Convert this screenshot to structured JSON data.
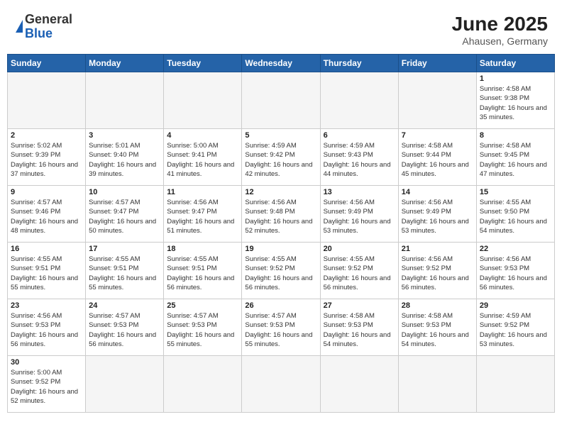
{
  "header": {
    "logo_general": "General",
    "logo_blue": "Blue",
    "month_title": "June 2025",
    "location": "Ahausen, Germany"
  },
  "calendar": {
    "days_of_week": [
      "Sunday",
      "Monday",
      "Tuesday",
      "Wednesday",
      "Thursday",
      "Friday",
      "Saturday"
    ],
    "weeks": [
      [
        {
          "day": "",
          "empty": true
        },
        {
          "day": "",
          "empty": true
        },
        {
          "day": "",
          "empty": true
        },
        {
          "day": "",
          "empty": true
        },
        {
          "day": "",
          "empty": true
        },
        {
          "day": "",
          "empty": true
        },
        {
          "day": "1",
          "info": "Sunrise: 4:58 AM\nSunset: 9:38 PM\nDaylight: 16 hours\nand 35 minutes."
        }
      ],
      [
        {
          "day": "2",
          "info": "Sunrise: 5:02 AM\nSunset: 9:39 PM\nDaylight: 16 hours\nand 37 minutes."
        },
        {
          "day": "3",
          "info": "Sunrise: 5:01 AM\nSunset: 9:40 PM\nDaylight: 16 hours\nand 39 minutes."
        },
        {
          "day": "4",
          "info": "Sunrise: 5:00 AM\nSunset: 9:41 PM\nDaylight: 16 hours\nand 41 minutes."
        },
        {
          "day": "5",
          "info": "Sunrise: 4:59 AM\nSunset: 9:42 PM\nDaylight: 16 hours\nand 42 minutes."
        },
        {
          "day": "6",
          "info": "Sunrise: 4:59 AM\nSunset: 9:43 PM\nDaylight: 16 hours\nand 44 minutes."
        },
        {
          "day": "7",
          "info": "Sunrise: 4:58 AM\nSunset: 9:44 PM\nDaylight: 16 hours\nand 45 minutes."
        },
        {
          "day": "8",
          "info": "Sunrise: 4:58 AM\nSunset: 9:45 PM\nDaylight: 16 hours\nand 47 minutes."
        }
      ],
      [
        {
          "day": "9",
          "info": "Sunrise: 4:57 AM\nSunset: 9:46 PM\nDaylight: 16 hours\nand 48 minutes."
        },
        {
          "day": "10",
          "info": "Sunrise: 4:57 AM\nSunset: 9:47 PM\nDaylight: 16 hours\nand 50 minutes."
        },
        {
          "day": "11",
          "info": "Sunrise: 4:56 AM\nSunset: 9:47 PM\nDaylight: 16 hours\nand 51 minutes."
        },
        {
          "day": "12",
          "info": "Sunrise: 4:56 AM\nSunset: 9:48 PM\nDaylight: 16 hours\nand 52 minutes."
        },
        {
          "day": "13",
          "info": "Sunrise: 4:56 AM\nSunset: 9:49 PM\nDaylight: 16 hours\nand 53 minutes."
        },
        {
          "day": "14",
          "info": "Sunrise: 4:56 AM\nSunset: 9:49 PM\nDaylight: 16 hours\nand 53 minutes."
        },
        {
          "day": "15",
          "info": "Sunrise: 4:55 AM\nSunset: 9:50 PM\nDaylight: 16 hours\nand 54 minutes."
        }
      ],
      [
        {
          "day": "16",
          "info": "Sunrise: 4:55 AM\nSunset: 9:51 PM\nDaylight: 16 hours\nand 55 minutes."
        },
        {
          "day": "17",
          "info": "Sunrise: 4:55 AM\nSunset: 9:51 PM\nDaylight: 16 hours\nand 55 minutes."
        },
        {
          "day": "18",
          "info": "Sunrise: 4:55 AM\nSunset: 9:51 PM\nDaylight: 16 hours\nand 56 minutes."
        },
        {
          "day": "19",
          "info": "Sunrise: 4:55 AM\nSunset: 9:52 PM\nDaylight: 16 hours\nand 56 minutes."
        },
        {
          "day": "20",
          "info": "Sunrise: 4:55 AM\nSunset: 9:52 PM\nDaylight: 16 hours\nand 56 minutes."
        },
        {
          "day": "21",
          "info": "Sunrise: 4:56 AM\nSunset: 9:52 PM\nDaylight: 16 hours\nand 56 minutes."
        },
        {
          "day": "22",
          "info": "Sunrise: 4:56 AM\nSunset: 9:53 PM\nDaylight: 16 hours\nand 56 minutes."
        }
      ],
      [
        {
          "day": "23",
          "info": "Sunrise: 4:56 AM\nSunset: 9:53 PM\nDaylight: 16 hours\nand 56 minutes."
        },
        {
          "day": "24",
          "info": "Sunrise: 4:57 AM\nSunset: 9:53 PM\nDaylight: 16 hours\nand 56 minutes."
        },
        {
          "day": "25",
          "info": "Sunrise: 4:57 AM\nSunset: 9:53 PM\nDaylight: 16 hours\nand 55 minutes."
        },
        {
          "day": "26",
          "info": "Sunrise: 4:57 AM\nSunset: 9:53 PM\nDaylight: 16 hours\nand 55 minutes."
        },
        {
          "day": "27",
          "info": "Sunrise: 4:58 AM\nSunset: 9:53 PM\nDaylight: 16 hours\nand 54 minutes."
        },
        {
          "day": "28",
          "info": "Sunrise: 4:58 AM\nSunset: 9:53 PM\nDaylight: 16 hours\nand 54 minutes."
        },
        {
          "day": "29",
          "info": "Sunrise: 4:59 AM\nSunset: 9:52 PM\nDaylight: 16 hours\nand 53 minutes."
        }
      ],
      [
        {
          "day": "30",
          "info": "Sunrise: 5:00 AM\nSunset: 9:52 PM\nDaylight: 16 hours\nand 52 minutes."
        },
        {
          "day": "",
          "empty": true
        },
        {
          "day": "",
          "empty": true
        },
        {
          "day": "",
          "empty": true
        },
        {
          "day": "",
          "empty": true
        },
        {
          "day": "",
          "empty": true
        },
        {
          "day": "",
          "empty": true
        }
      ]
    ]
  }
}
